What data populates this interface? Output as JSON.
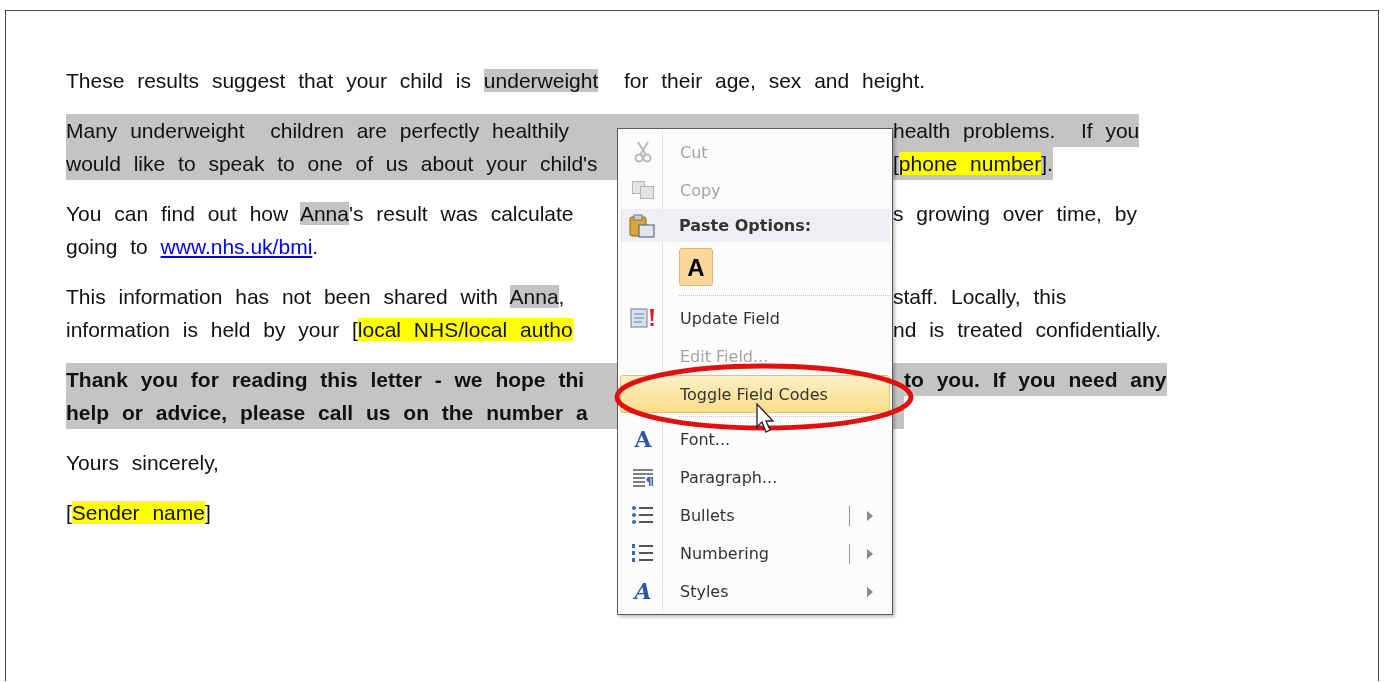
{
  "document": {
    "paragraphs": [
      {
        "shaded": false,
        "bold": false,
        "lines": [
          {
            "left": [
              {
                "text": "These results suggest that your child is "
              },
              {
                "text": "underweight",
                "kind": "field"
              },
              {
                "text": "  for their age, sex and height."
              }
            ]
          }
        ]
      },
      {
        "shaded": true,
        "bold": false,
        "lines": [
          {
            "left": [
              {
                "text": "Many underweight  children are perfectly healthily"
              }
            ],
            "right": [
              {
                "text": "health problems.  If you"
              }
            ]
          },
          {
            "left": [
              {
                "text": "would like to speak to one of us about your child's"
              }
            ],
            "right": [
              {
                "text": "["
              },
              {
                "text": "phone number",
                "kind": "placeholder"
              },
              {
                "text": "]."
              }
            ]
          }
        ]
      },
      {
        "shaded": false,
        "bold": false,
        "lines": [
          {
            "left": [
              {
                "text": "You can find out how "
              },
              {
                "text": "Anna",
                "kind": "field"
              },
              {
                "text": "'s result was calculate"
              }
            ],
            "right": [
              {
                "text": "s growing over time, by"
              }
            ]
          },
          {
            "left": [
              {
                "text": "going to "
              },
              {
                "text": "www.nhs.uk/bmi",
                "kind": "link"
              },
              {
                "text": "."
              }
            ]
          }
        ]
      },
      {
        "shaded": false,
        "bold": false,
        "lines": [
          {
            "left": [
              {
                "text": "This information has not been shared with "
              },
              {
                "text": "Anna",
                "kind": "field"
              },
              {
                "text": ","
              }
            ],
            "right": [
              {
                "text": "staff. Locally, this"
              }
            ]
          },
          {
            "left": [
              {
                "text": "information is held by your ["
              },
              {
                "text": "local NHS/local autho",
                "kind": "placeholder"
              }
            ],
            "right": [
              {
                "text": "nd is treated confidentially."
              }
            ]
          }
        ]
      },
      {
        "shaded": true,
        "bold": true,
        "lines": [
          {
            "left": [
              {
                "text": "Thank you for reading this letter - we hope thi"
              }
            ],
            "right": [
              {
                "text": "to you. If you need any"
              }
            ]
          },
          {
            "left": [
              {
                "text": "help or advice, please call us on the number a"
              }
            ]
          }
        ]
      },
      {
        "shaded": false,
        "bold": false,
        "lines": [
          {
            "left": [
              {
                "text": "Yours sincerely,"
              }
            ]
          }
        ]
      },
      {
        "shaded": false,
        "bold": false,
        "lines": [
          {
            "left": [
              {
                "text": "["
              },
              {
                "text": "Sender name",
                "kind": "placeholder"
              },
              {
                "text": "]"
              }
            ]
          }
        ]
      }
    ]
  },
  "context_menu": {
    "items": [
      {
        "kind": "command",
        "label": "Cut",
        "disabled": true,
        "selected": false
      },
      {
        "kind": "command",
        "label": "Copy",
        "disabled": true,
        "selected": false
      },
      {
        "kind": "header",
        "label": "Paste Options:"
      },
      {
        "kind": "paste",
        "label": "A"
      },
      {
        "kind": "separator"
      },
      {
        "kind": "command",
        "label": "Update Field",
        "disabled": false,
        "selected": false
      },
      {
        "kind": "command",
        "label": "Edit Field...",
        "disabled": true,
        "selected": false
      },
      {
        "kind": "command",
        "label": "Toggle Field Codes",
        "disabled": false,
        "selected": true,
        "circled": true
      },
      {
        "kind": "separator"
      },
      {
        "kind": "command",
        "label": "Font...",
        "icon_text": "A",
        "disabled": false,
        "selected": false
      },
      {
        "kind": "command",
        "label": "Paragraph...",
        "disabled": false,
        "selected": false
      },
      {
        "kind": "command",
        "label": "Bullets",
        "disabled": false,
        "selected": false,
        "submenu": true,
        "split": true
      },
      {
        "kind": "command",
        "label": "Numbering",
        "disabled": false,
        "selected": false,
        "submenu": true,
        "split": true
      },
      {
        "kind": "command",
        "label": "Styles",
        "icon_text": "A",
        "disabled": false,
        "selected": false,
        "submenu": true
      }
    ]
  }
}
